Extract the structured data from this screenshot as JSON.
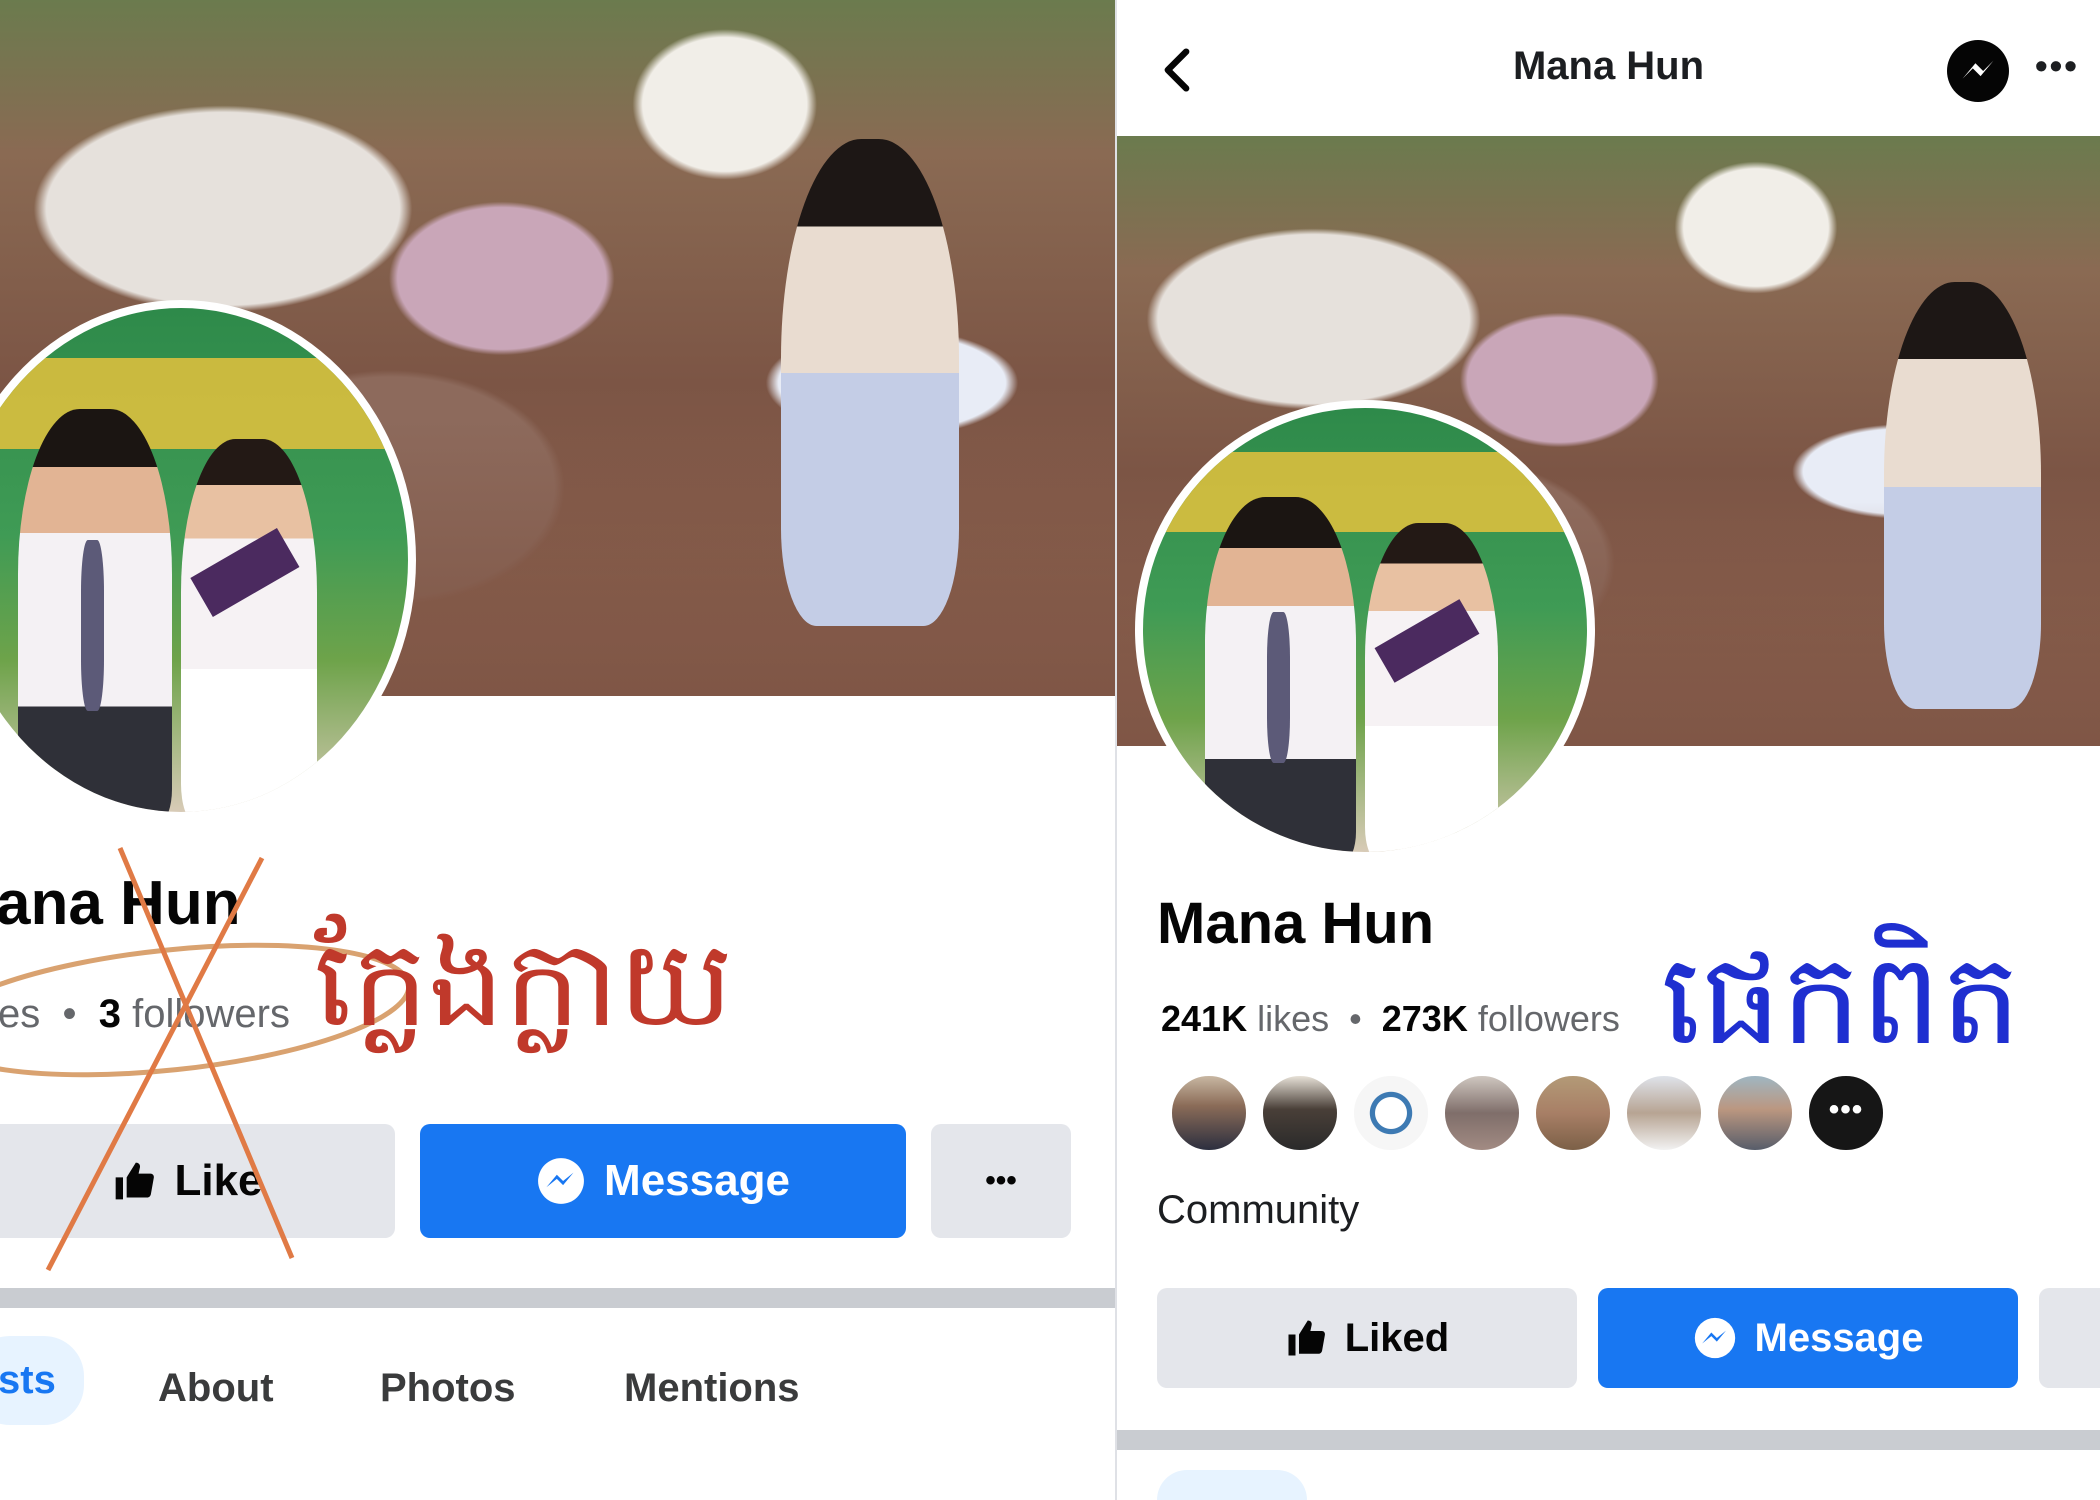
{
  "left": {
    "name": "ana Hun",
    "stats": {
      "likes_label": "es",
      "followers_count": "3",
      "followers_label": "followers"
    },
    "buttons": {
      "like": "Like",
      "message": "Message",
      "more": "•••"
    },
    "tabs": {
      "posts": "sts",
      "about": "About",
      "photos": "Photos",
      "mentions": "Mentions"
    },
    "annotation": "ក្លែងក្លាយ",
    "annotation_color": "#c0392b"
  },
  "right": {
    "header_title": "Mana Hun",
    "more_icon": "•••",
    "name": "Mana Hun",
    "stats": {
      "likes_count": "241K",
      "likes_label": "likes",
      "followers_count": "273K",
      "followers_label": "followers"
    },
    "friends_more": "•••",
    "category": "Community",
    "buttons": {
      "liked": "Liked",
      "message": "Message"
    },
    "annotation": "ផេកពិត",
    "annotation_color": "#1f2fd0"
  },
  "colors": {
    "facebook_blue": "#1877f2",
    "button_grey": "#e4e6eb",
    "text_secondary": "#65676b"
  }
}
